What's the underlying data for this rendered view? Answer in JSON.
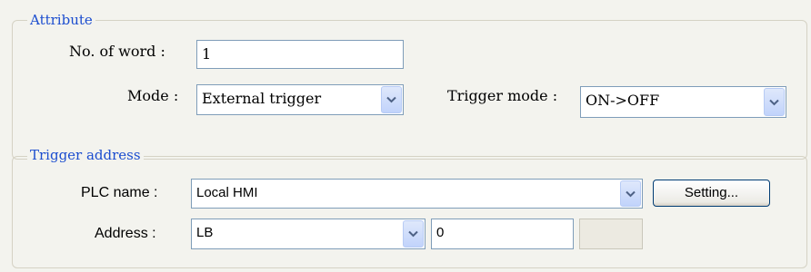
{
  "attribute": {
    "title": "Attribute",
    "no_of_word_label": "No. of word :",
    "no_of_word_value": "1",
    "mode_label": "Mode :",
    "mode_value": "External trigger",
    "trigger_mode_label": "Trigger mode :",
    "trigger_mode_value": "ON->OFF"
  },
  "trigger_address": {
    "title": "Trigger address",
    "plc_name_label": "PLC name :",
    "plc_name_value": "Local HMI",
    "setting_button_label": "Setting...",
    "address_label": "Address :",
    "address_device_value": "LB",
    "address_number_value": "0",
    "address_extra_value": ""
  },
  "icons": {
    "dropdown": "chevron-down-icon"
  }
}
